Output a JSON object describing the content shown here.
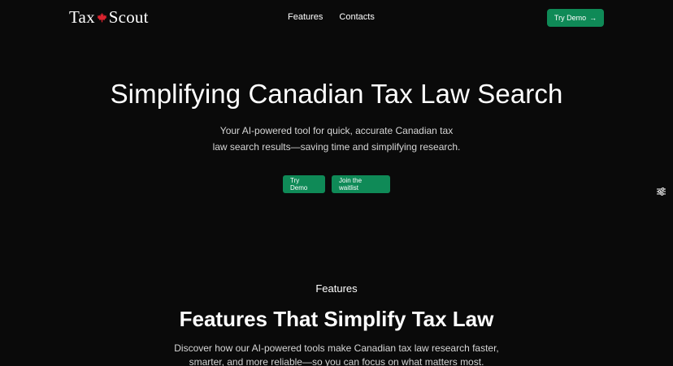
{
  "header": {
    "logo_left": "Tax",
    "logo_right": "Scout",
    "nav": [
      "Features",
      "Contacts"
    ],
    "cta_label": "Try Demo",
    "cta_arrow": "→"
  },
  "hero": {
    "title": "Simplifying Canadian Tax Law Search",
    "subtitle_line1": "Your AI-powered tool for quick, accurate Canadian tax",
    "subtitle_line2": "law search results—saving time and simplifying research.",
    "primary_button": "Try Demo",
    "secondary_button": "Join the waitlist"
  },
  "features": {
    "eyebrow": "Features",
    "title": "Features That Simplify Tax Law",
    "subtitle_line1": "Discover how our AI-powered tools make Canadian tax law research faster,",
    "subtitle_line2": "smarter, and more reliable—so you can focus on what matters most."
  },
  "colors": {
    "background": "#0a0a0a",
    "accent": "#0f8a57",
    "maple": "#d9232e"
  },
  "icons": {
    "logo_mark": "maple-leaf-icon",
    "side_widget": "settings-sliders-icon"
  }
}
